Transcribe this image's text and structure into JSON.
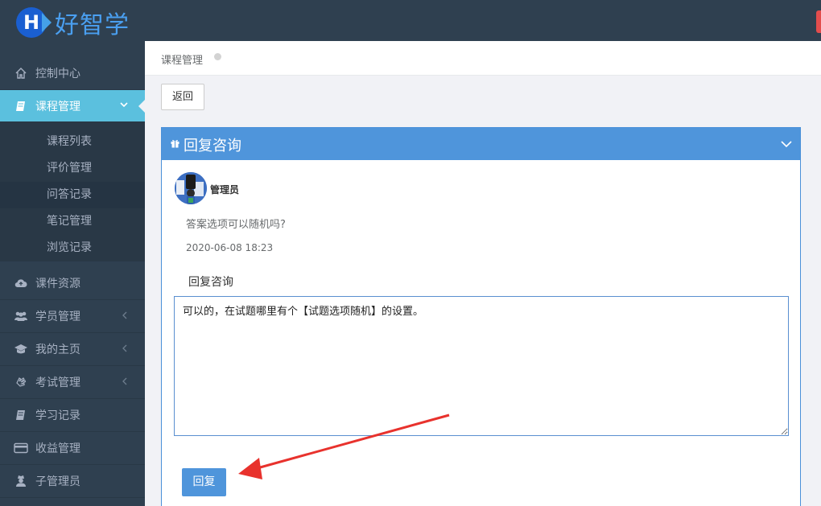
{
  "brand": {
    "logo_letter": "H",
    "name": "好智学"
  },
  "sidebar": {
    "items": [
      {
        "label": "控制中心",
        "icon": "home-icon"
      },
      {
        "label": "课程管理",
        "icon": "book-icon",
        "active": true
      },
      {
        "label": "课件资源",
        "icon": "cloud-upload-icon"
      },
      {
        "label": "学员管理",
        "icon": "users-icon"
      },
      {
        "label": "我的主页",
        "icon": "graduation-cap-icon"
      },
      {
        "label": "考试管理",
        "icon": "hand-icon"
      },
      {
        "label": "学习记录",
        "icon": "book-icon"
      },
      {
        "label": "收益管理",
        "icon": "credit-card-icon"
      },
      {
        "label": "子管理员",
        "icon": "user-secret-icon"
      }
    ],
    "subitems": [
      {
        "label": "课程列表"
      },
      {
        "label": "评价管理"
      },
      {
        "label": "问答记录",
        "current": true
      },
      {
        "label": "笔记管理"
      },
      {
        "label": "浏览记录"
      }
    ]
  },
  "breadcrumb": {
    "label": "课程管理"
  },
  "toolbar": {
    "back_label": "返回"
  },
  "panel": {
    "title": "回复咨询",
    "user": {
      "name": "管理员"
    },
    "question": "答案选项可以随机吗?",
    "time": "2020-06-08 18:23",
    "reply_label": "回复咨询",
    "reply_text": "可以的，在试题哪里有个【试题选项随机】的设置。",
    "submit_label": "回复"
  },
  "colors": {
    "sidebar_bg": "#2f4050",
    "active": "#5bc0de",
    "primary": "#4f95db",
    "annotation": "#e8322d"
  }
}
